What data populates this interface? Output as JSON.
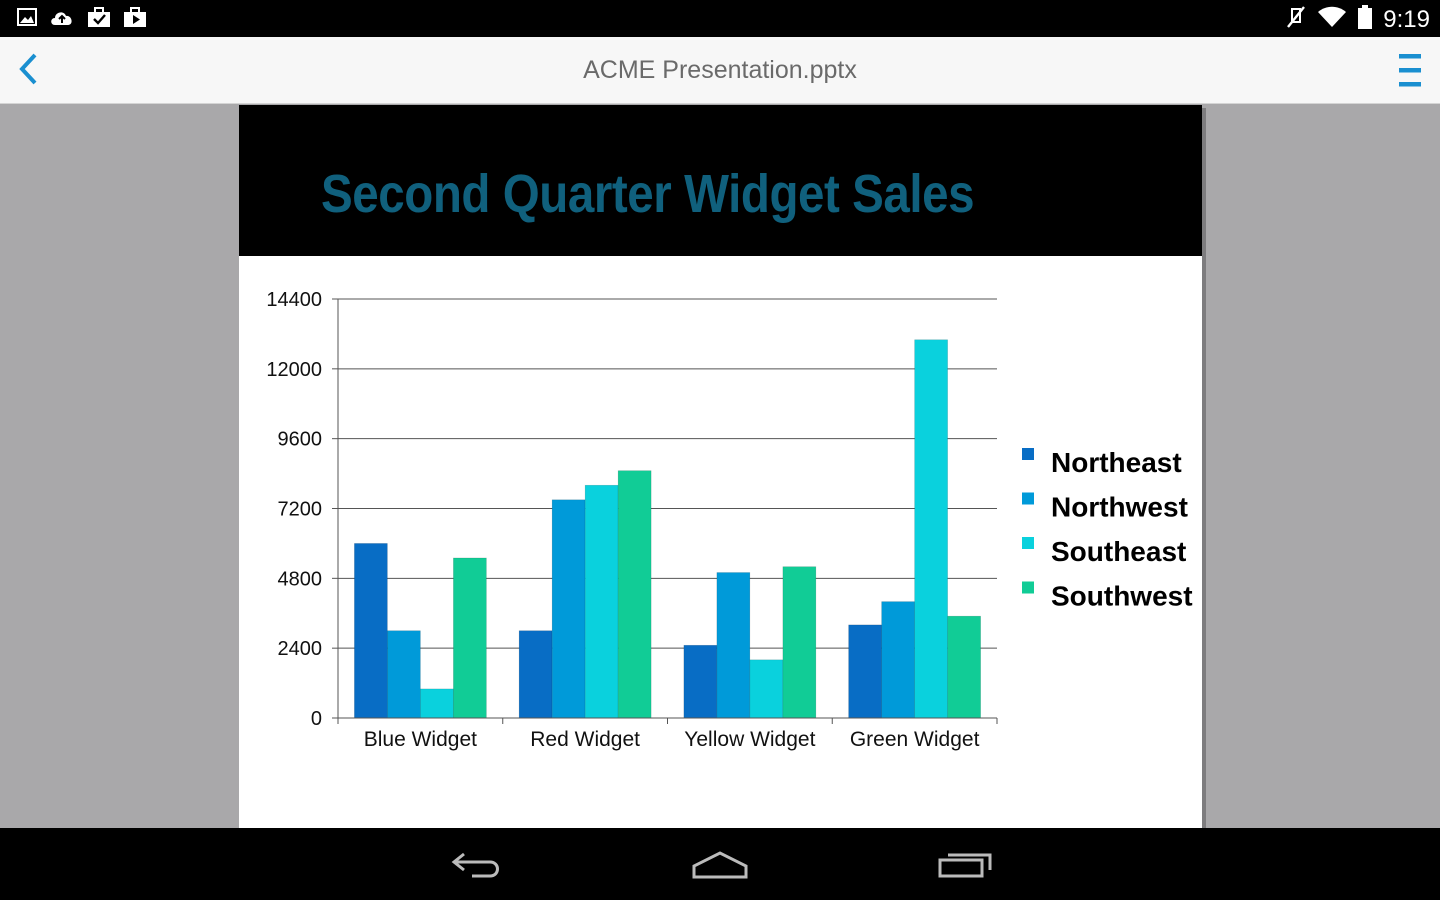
{
  "status_bar": {
    "time": "9:19",
    "left_icons": [
      "gallery-icon",
      "cloud-upload-icon",
      "briefcase-check-icon",
      "briefcase-play-icon"
    ],
    "right_icons": [
      "mute-icon",
      "wifi-icon",
      "battery-icon"
    ]
  },
  "action_bar": {
    "title": "ACME Presentation.pptx",
    "back_icon": "chevron-left-icon",
    "menu_icon": "menu-icon",
    "accent_color": "#1a8fd0"
  },
  "slide": {
    "title": "Second Quarter Widget Sales",
    "title_color": "#10607d",
    "header_background": "#000000"
  },
  "chart_data": {
    "type": "bar",
    "title": "Second Quarter Widget Sales",
    "categories": [
      "Blue Widget",
      "Red Widget",
      "Yellow Widget",
      "Green Widget"
    ],
    "series": [
      {
        "name": "Northeast",
        "color": "#086dc5",
        "values": [
          6000,
          3000,
          2500,
          3200
        ]
      },
      {
        "name": "Northwest",
        "color": "#009ad9",
        "values": [
          3000,
          7500,
          5000,
          4000
        ]
      },
      {
        "name": "Southeast",
        "color": "#0ad1dd",
        "values": [
          1000,
          8000,
          2000,
          13000
        ]
      },
      {
        "name": "Southwest",
        "color": "#11cc96",
        "values": [
          5500,
          8500,
          5200,
          3500
        ]
      }
    ],
    "yticks": [
      "0",
      "2400",
      "4800",
      "7200",
      "9600",
      "12000",
      "14400"
    ],
    "ylim": [
      0,
      14400
    ],
    "grid": true,
    "legend_position": "right"
  },
  "nav_bar": {
    "icons": [
      "back-icon",
      "home-icon",
      "recent-apps-icon"
    ]
  }
}
